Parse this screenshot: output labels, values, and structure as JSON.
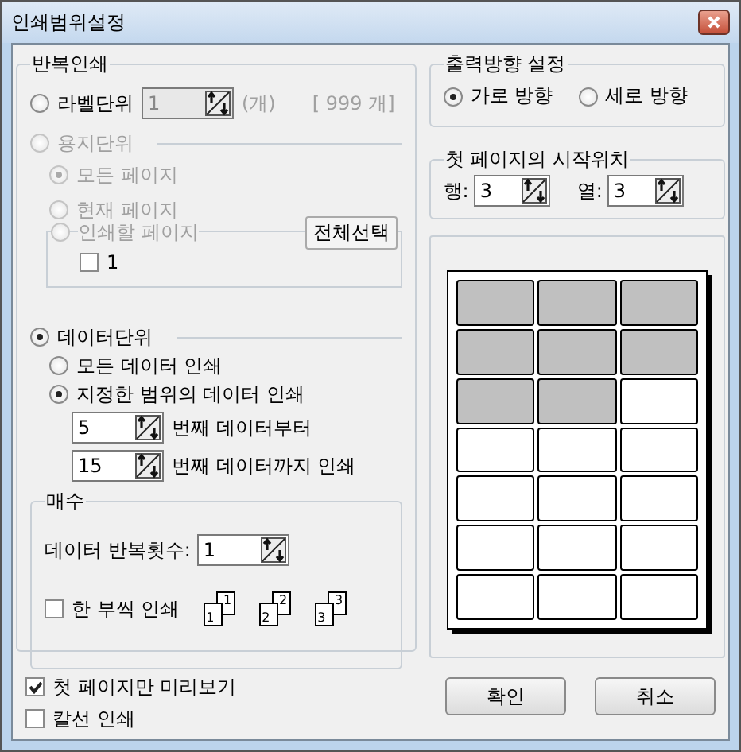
{
  "window": {
    "title": "인쇄범위설정"
  },
  "repeat_print": {
    "title": "반복인쇄",
    "label_unit": {
      "label": "라벨단위",
      "selected": false,
      "value": "1",
      "field_disabled": true,
      "unit": "(개)",
      "max": "[ 999 개]"
    },
    "paper_unit": {
      "label": "용지단위",
      "selected": false,
      "disabled": true,
      "options": [
        {
          "label": "모든 페이지",
          "selected": true
        },
        {
          "label": "현재 페이지",
          "selected": false
        }
      ],
      "pages": {
        "label": "인쇄할 페이지",
        "selected": false,
        "button": "전체선택",
        "items": [
          {
            "label": "1",
            "checked": false
          }
        ]
      }
    },
    "data_unit": {
      "label": "데이터단위",
      "selected": true,
      "options": [
        {
          "label": "모든 데이터 인쇄",
          "selected": false
        },
        {
          "label": "지정한 범위의 데이터 인쇄",
          "selected": true
        }
      ],
      "from": {
        "value": "5",
        "label": "번째 데이터부터"
      },
      "to": {
        "value": "15",
        "label": "번째 데이터까지 인쇄"
      }
    },
    "copies": {
      "title": "매수",
      "repeat_label": "데이터 반복횟수:",
      "repeat_value": "1",
      "collate": {
        "label": "한 부씩 인쇄",
        "checked": false
      },
      "collate_icons": [
        {
          "front": "1",
          "back": "1"
        },
        {
          "front": "2",
          "back": "2"
        },
        {
          "front": "3",
          "back": "3"
        }
      ]
    }
  },
  "orientation": {
    "title": "출력방향 설정",
    "options": [
      {
        "label": "가로 방향",
        "selected": true
      },
      {
        "label": "세로 방향",
        "selected": false
      }
    ]
  },
  "start_position": {
    "title": "첫 페이지의 시작위치",
    "row_label": "행:",
    "row": "3",
    "col_label": "열:",
    "col": "3"
  },
  "preview": {
    "rows": [
      [
        {
          "filled": true
        },
        {
          "filled": true
        },
        {
          "filled": true
        }
      ],
      [
        {
          "filled": true
        },
        {
          "filled": true
        },
        {
          "filled": true
        }
      ],
      [
        {
          "filled": true
        },
        {
          "filled": true
        },
        {
          "filled": false
        }
      ],
      [
        {
          "filled": false
        },
        {
          "filled": false
        },
        {
          "filled": false
        }
      ],
      [
        {
          "filled": false
        },
        {
          "filled": false
        },
        {
          "filled": false
        }
      ],
      [
        {
          "filled": false
        },
        {
          "filled": false
        },
        {
          "filled": false
        }
      ],
      [
        {
          "filled": false
        },
        {
          "filled": false
        },
        {
          "filled": false
        }
      ]
    ]
  },
  "options": [
    {
      "label": "첫 페이지만 미리보기",
      "checked": true
    },
    {
      "label": "칼선 인쇄",
      "checked": false
    }
  ],
  "buttons": [
    "확인",
    "취소"
  ]
}
